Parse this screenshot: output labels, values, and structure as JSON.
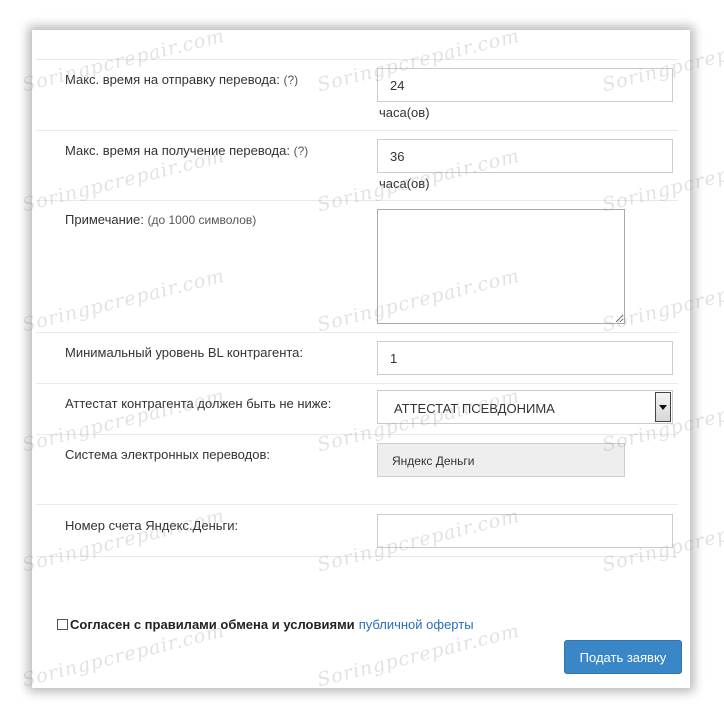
{
  "form": {
    "send_time": {
      "label": "Макс. время на отправку перевода:",
      "hint": "(?)",
      "value": "24",
      "unit": "часа(ов)"
    },
    "receive_time": {
      "label": "Макс. время на получение перевода:",
      "hint": "(?)",
      "value": "36",
      "unit": "часа(ов)"
    },
    "note": {
      "label": "Примечание:",
      "hint": "(до 1000 символов)",
      "value": ""
    },
    "min_bl": {
      "label": "Минимальный уровень BL контрагента:",
      "value": "1"
    },
    "attestat": {
      "label": "Аттестат контрагента должен быть не ниже:",
      "selected": "АТТЕСТАТ ПСЕВДОНИМА"
    },
    "payment_system": {
      "label": "Система электронных переводов:",
      "value": "Яндекс Деньги"
    },
    "account": {
      "label": "Номер счета Яндекс.Деньги:",
      "value": ""
    }
  },
  "agreement": {
    "bold_text": "Согласен с правилами обмена и условиями",
    "link_text": "публичной оферты",
    "checked": false
  },
  "submit_label": "Подать заявку",
  "watermark_text": "Soringpcrepair.com",
  "colors": {
    "button": "#3a87c8",
    "link": "#2a6ebb",
    "readonly_bg": "#eeeeee"
  }
}
